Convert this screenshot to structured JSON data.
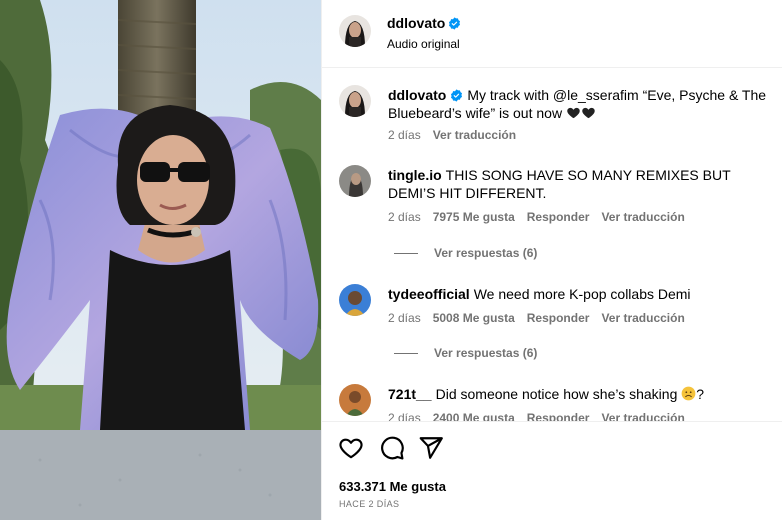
{
  "post": {
    "username": "ddlovato",
    "audio_label": "Audio original"
  },
  "caption": {
    "username": "ddlovato",
    "text": "My track with @le_sserafim “Eve, Psyche & The Bluebeard’s wife” is out now",
    "emoji": [
      "black-heart",
      "black-heart"
    ],
    "time": "2 días",
    "translate": "Ver traducción"
  },
  "comments": [
    {
      "username": "tingle.io",
      "text": "THIS SONG HAVE SO MANY REMIXES BUT DEMI’S HIT DIFFERENT.",
      "time": "2 días",
      "likes": "7975 Me gusta",
      "reply": "Responder",
      "translate": "Ver traducción",
      "replies": "Ver respuestas (6)"
    },
    {
      "username": "tydeeofficial",
      "text": "We need more K-pop collabs Demi",
      "time": "2 días",
      "likes": "5008 Me gusta",
      "reply": "Responder",
      "translate": "Ver traducción",
      "replies": "Ver respuestas (6)"
    },
    {
      "username": "721t__",
      "text": "Did someone notice how she’s shaking",
      "text_suffix": "?",
      "emoji": "worried-face",
      "time": "2 días",
      "likes": "2400 Me gusta",
      "reply": "Responder",
      "translate": "Ver traducción"
    }
  ],
  "actions": {
    "icons": [
      "heart-icon",
      "comment-icon",
      "share-icon"
    ],
    "likes": "633.371 Me gusta",
    "posted": "HACE 2 DÍAS"
  },
  "colors": {
    "verified": "#0095f6",
    "meta_text": "#737373",
    "divider": "#efefef"
  }
}
